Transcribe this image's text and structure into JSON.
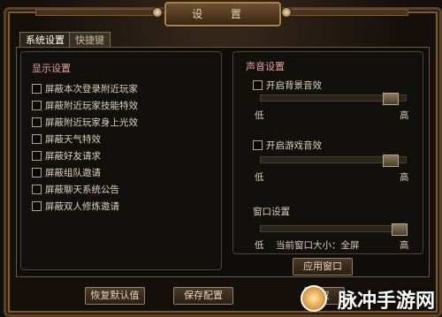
{
  "window": {
    "title": "设  置"
  },
  "tabs": [
    {
      "label": "系统设置",
      "active": true
    },
    {
      "label": "快捷键",
      "active": false
    }
  ],
  "display": {
    "title": "显示设置",
    "options": [
      {
        "label": "屏蔽本次登录附近玩家",
        "checked": false
      },
      {
        "label": "屏蔽附近玩家技能特效",
        "checked": false
      },
      {
        "label": "屏蔽附近玩家身上光效",
        "checked": false
      },
      {
        "label": "屏蔽天气特效",
        "checked": false
      },
      {
        "label": "屏蔽好友请求",
        "checked": false
      },
      {
        "label": "屏蔽组队邀请",
        "checked": false
      },
      {
        "label": "屏蔽聊天系统公告",
        "checked": false
      },
      {
        "label": "屏蔽双人修炼邀请",
        "checked": false
      }
    ]
  },
  "sound": {
    "title": "声音设置",
    "bgm_label": "开启背景音效",
    "game_label": "开启游戏音效",
    "low": "低",
    "high": "高",
    "bgm_level": 0.93,
    "game_level": 0.93
  },
  "window_settings": {
    "title": "窗口设置",
    "low": "低",
    "high": "高",
    "size_text": "当前窗口大小：全屏",
    "level": 1.0,
    "apply_button": "应用窗口"
  },
  "footer": {
    "restore_button": "恢复默认值",
    "save_button": "保存配置",
    "cancel_button": "取"
  },
  "watermark": {
    "text": "脉冲手游网"
  }
}
